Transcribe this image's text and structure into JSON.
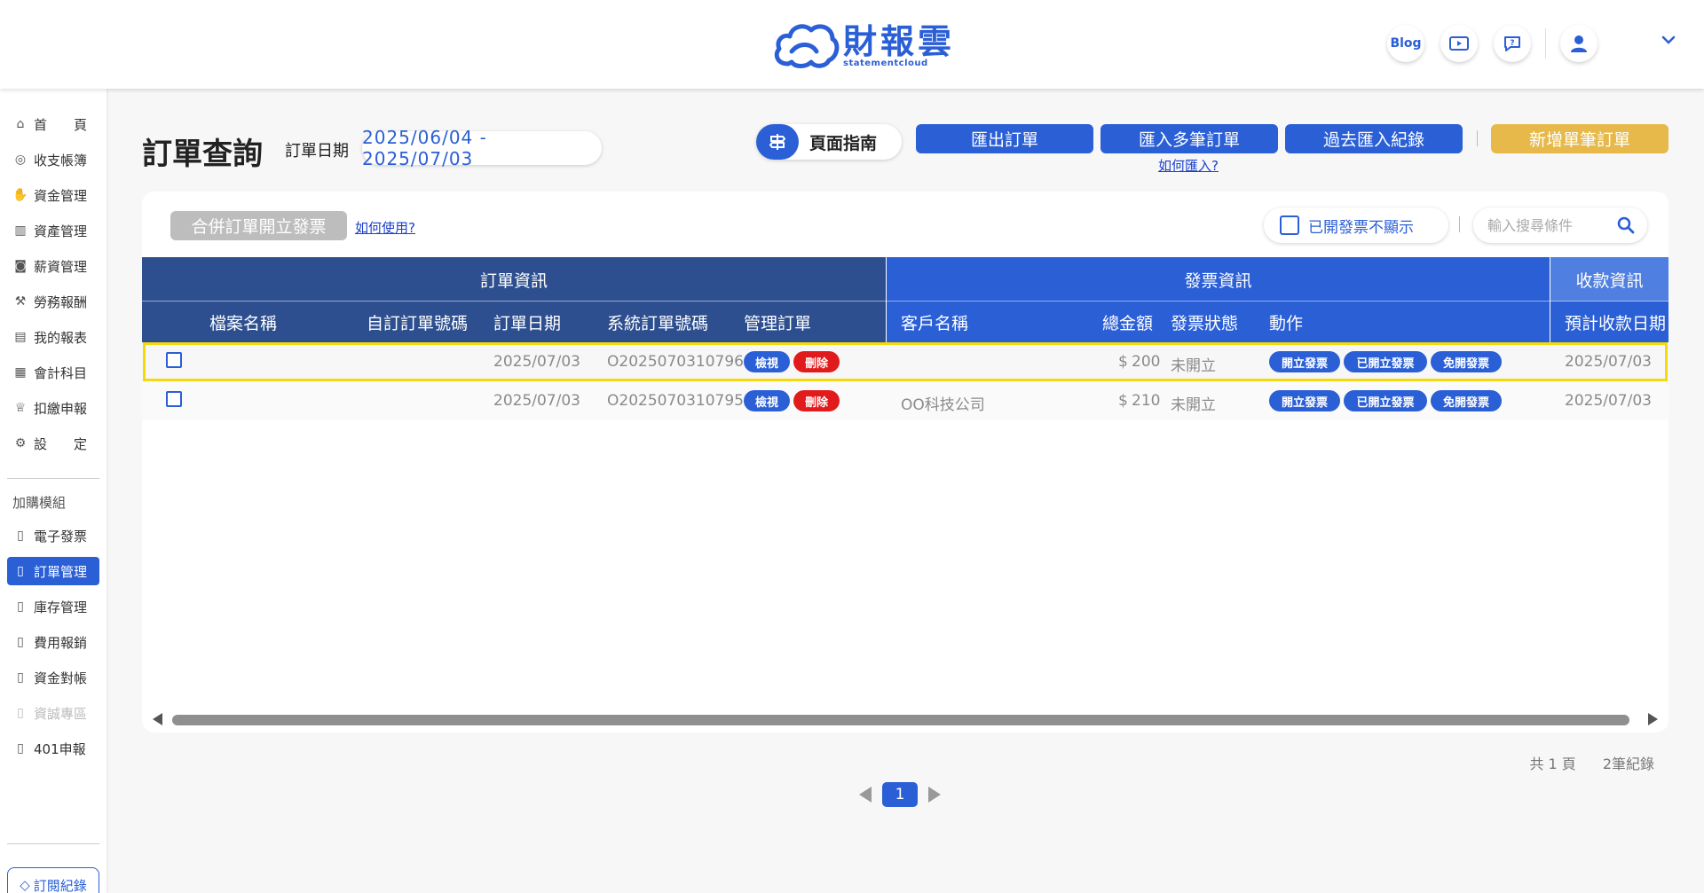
{
  "brand": {
    "name_zh": "財報雲",
    "name_en": "statementcloud",
    "blog_label": "Blog"
  },
  "sidebar": {
    "items": [
      {
        "label": "首　　頁",
        "icon": "home-icon"
      },
      {
        "label": "收支帳簿",
        "icon": "coin-icon"
      },
      {
        "label": "資金管理",
        "icon": "money-hand-icon"
      },
      {
        "label": "資產管理",
        "icon": "chart-icon"
      },
      {
        "label": "薪資管理",
        "icon": "salary-icon"
      },
      {
        "label": "勞務報酬",
        "icon": "labor-icon"
      },
      {
        "label": "我的報表",
        "icon": "report-icon"
      },
      {
        "label": "會計科目",
        "icon": "ledger-icon"
      },
      {
        "label": "扣繳申報",
        "icon": "tax-icon"
      },
      {
        "label": "設　　定",
        "icon": "settings-icon"
      }
    ],
    "addon_group_label": "加購模組",
    "addons": [
      {
        "label": "電子發票",
        "state": "normal"
      },
      {
        "label": "訂單管理",
        "state": "active"
      },
      {
        "label": "庫存管理",
        "state": "normal"
      },
      {
        "label": "費用報銷",
        "state": "normal"
      },
      {
        "label": "資金對帳",
        "state": "normal"
      },
      {
        "label": "資誠專區",
        "state": "disabled"
      },
      {
        "label": "401申報",
        "state": "normal"
      }
    ],
    "subscription_label": "訂閱紀錄"
  },
  "page": {
    "title": "訂單查詢",
    "date_label": "訂單日期",
    "date_range": "2025/06/04 - 2025/07/03",
    "guide_label": "頁面指南",
    "buttons": {
      "export_orders": "匯出訂單",
      "import_multi": "匯入多筆訂單",
      "import_history": "過去匯入紀錄",
      "add_single": "新增單筆訂單"
    },
    "how_import_link": "如何匯入?"
  },
  "toolbar": {
    "merge_invoice_label": "合併訂單開立發票",
    "how_use_link": "如何使用?",
    "hide_issued_label": "已開發票不顯示",
    "search_placeholder": "輸入搜尋條件"
  },
  "table": {
    "groups": {
      "order_info": "訂單資訊",
      "invoice_info": "發票資訊",
      "payment_info": "收款資訊"
    },
    "columns": {
      "file_name": "檔案名稱",
      "custom_order_no": "自訂訂單號碼",
      "order_date": "訂單日期",
      "system_order_no": "系統訂單號碼",
      "manage_order": "管理訂單",
      "customer_name": "客戶名稱",
      "total_amount": "總金額",
      "invoice_status": "發票狀態",
      "actions": "動作",
      "expected_payment_date": "預計收款日期"
    },
    "rows": [
      {
        "file_name": "",
        "custom_order_no": "",
        "order_date": "2025/07/03",
        "system_order_no": "O2025070310796",
        "view_label": "檢視",
        "delete_label": "刪除",
        "customer_name": "",
        "currency": "$",
        "amount": "200",
        "invoice_status": "未開立",
        "issue_label": "開立發票",
        "issued_label": "已開立發票",
        "exempt_label": "免開發票",
        "expected_payment_date": "2025/07/03",
        "highlighted": true
      },
      {
        "file_name": "",
        "custom_order_no": "",
        "order_date": "2025/07/03",
        "system_order_no": "O2025070310795",
        "view_label": "檢視",
        "delete_label": "刪除",
        "customer_name": "OO科技公司",
        "currency": "$",
        "amount": "210",
        "invoice_status": "未開立",
        "issue_label": "開立發票",
        "issued_label": "已開立發票",
        "exempt_label": "免開發票",
        "expected_payment_date": "2025/07/03",
        "highlighted": false
      }
    ]
  },
  "footer": {
    "total_pages_text": "共 1 頁",
    "total_records_text": "2筆紀錄",
    "current_page": "1"
  },
  "colors": {
    "primary": "#2a5fd6",
    "header_dark": "#2d4f8f",
    "gold": "#e6b94a",
    "danger": "#e11b1b",
    "highlight": "#f5d90a"
  }
}
